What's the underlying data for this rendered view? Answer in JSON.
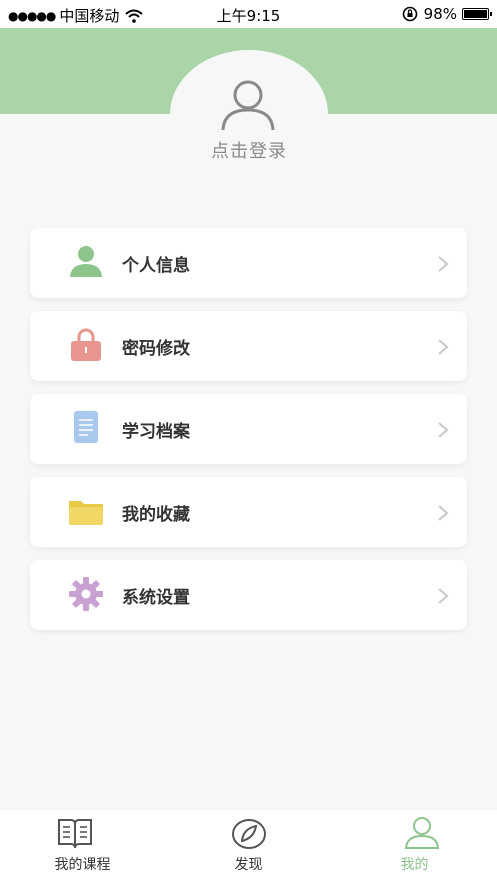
{
  "status_bar": {
    "signal": "●●●●●",
    "carrier": "中国移动",
    "time": "上午9:15",
    "battery": "98%"
  },
  "profile": {
    "login_label": "点击登录"
  },
  "menu": [
    {
      "label": "个人信息",
      "icon": "person-icon",
      "color": "#8cc48c"
    },
    {
      "label": "密码修改",
      "icon": "lock-icon",
      "color": "#e8958f"
    },
    {
      "label": "学习档案",
      "icon": "document-icon",
      "color": "#a9c8ee"
    },
    {
      "label": "我的收藏",
      "icon": "folder-icon",
      "color": "#f2d766"
    },
    {
      "label": "系统设置",
      "icon": "gear-icon",
      "color": "#c9a2d4"
    }
  ],
  "tabs": [
    {
      "label": "我的课程",
      "icon": "book-icon"
    },
    {
      "label": "发现",
      "icon": "compass-icon"
    },
    {
      "label": "我的",
      "icon": "person-outline-icon",
      "active": true
    }
  ],
  "colors": {
    "header": "#a9d5a9",
    "accent": "#8cc48c",
    "background": "#f7f7f7"
  }
}
